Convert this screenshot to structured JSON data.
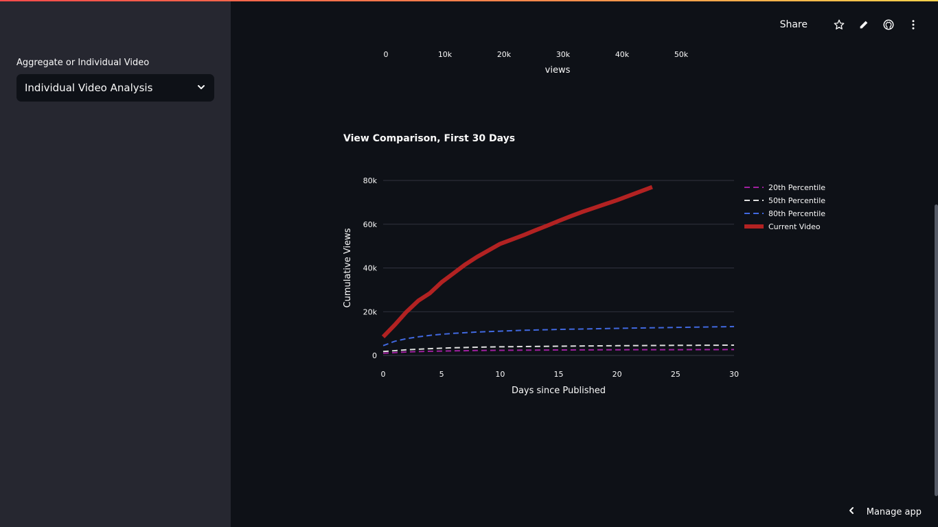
{
  "sidebar": {
    "label": "Aggregate or Individual Video",
    "select_value": "Individual Video Analysis"
  },
  "header": {
    "share_label": "Share",
    "icons": [
      "star-icon",
      "pencil-icon",
      "github-icon",
      "more-vertical-icon"
    ]
  },
  "previous_chart": {
    "x_ticks": [
      "0",
      "10k",
      "20k",
      "30k",
      "40k",
      "50k"
    ],
    "x_label": "views"
  },
  "footer": {
    "manage_app_label": "Manage app"
  },
  "colors": {
    "accent_start": "#ff4b4b",
    "accent_end": "#ffd24b",
    "series_20th": "#a020a0",
    "series_50th": "#e0e0e0",
    "series_80th": "#4169e1",
    "series_current": "#b22222"
  },
  "chart_data": {
    "type": "line",
    "title": "View Comparison, First 30 Days",
    "xlabel": "Days since Published",
    "ylabel": "Cumulative Views",
    "xlim": [
      0,
      30
    ],
    "ylim": [
      0,
      80000
    ],
    "x_ticks": [
      0,
      5,
      10,
      15,
      20,
      25,
      30
    ],
    "y_ticks": [
      0,
      20000,
      40000,
      60000,
      80000
    ],
    "y_tick_labels": [
      "0",
      "20k",
      "40k",
      "60k",
      "80k"
    ],
    "grid": true,
    "legend_position": "top-right",
    "series": [
      {
        "name": "20th Percentile",
        "style": "dashed",
        "x": [
          0,
          2,
          4,
          6,
          8,
          10,
          15,
          20,
          25,
          30
        ],
        "y": [
          1000,
          1600,
          1900,
          2100,
          2250,
          2350,
          2500,
          2600,
          2650,
          2700
        ]
      },
      {
        "name": "50th Percentile",
        "style": "dashed",
        "x": [
          0,
          2,
          4,
          6,
          8,
          10,
          15,
          20,
          25,
          30
        ],
        "y": [
          1800,
          2600,
          3100,
          3500,
          3750,
          3950,
          4250,
          4450,
          4600,
          4700
        ]
      },
      {
        "name": "80th Percentile",
        "style": "dashed",
        "x": [
          0,
          1,
          2,
          3,
          4,
          5,
          6,
          8,
          10,
          12,
          15,
          20,
          25,
          30
        ],
        "y": [
          4500,
          6500,
          7700,
          8500,
          9200,
          9700,
          10100,
          10700,
          11100,
          11500,
          11900,
          12400,
          12800,
          13200
        ]
      },
      {
        "name": "Current Video",
        "style": "solid",
        "x": [
          0,
          1,
          2,
          3,
          4,
          5,
          6,
          7,
          8,
          9,
          10,
          11,
          12,
          13,
          14,
          15,
          16,
          17,
          18,
          19,
          20,
          21,
          22,
          23
        ],
        "y": [
          8500,
          14000,
          20000,
          25000,
          28500,
          33500,
          37500,
          41500,
          45000,
          48000,
          51000,
          53000,
          55000,
          57200,
          59300,
          61500,
          63600,
          65600,
          67400,
          69200,
          71000,
          73000,
          75000,
          77000
        ]
      }
    ]
  }
}
